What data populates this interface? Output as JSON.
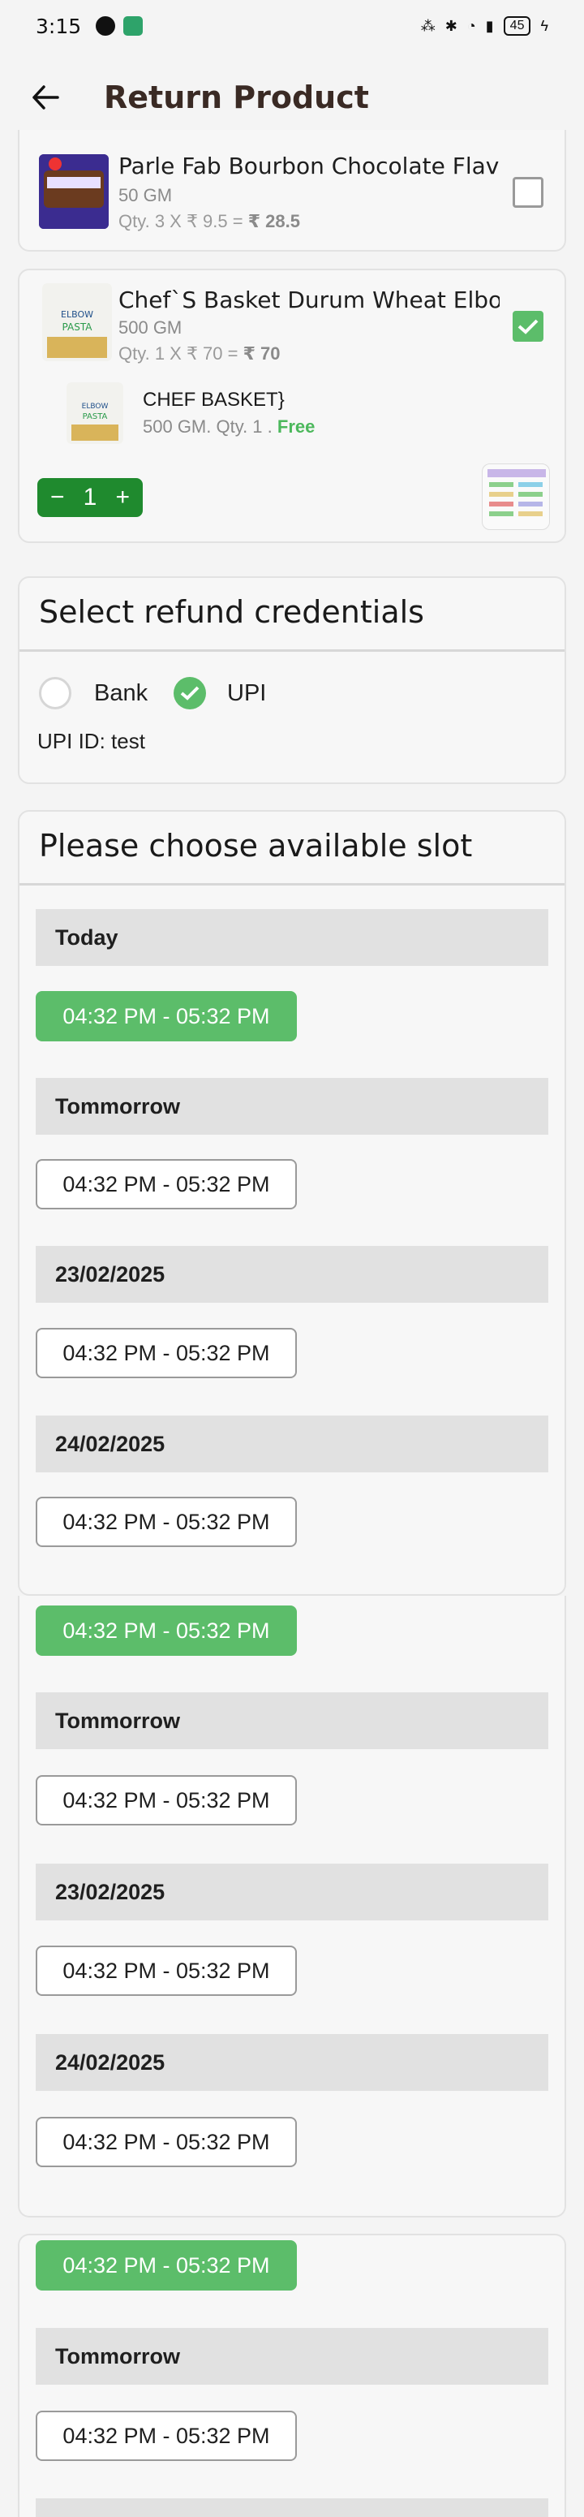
{
  "status_bar": {
    "time": "3:15",
    "battery": "45"
  },
  "header": {
    "title": "Return Product"
  },
  "products": [
    {
      "name": "Parle Fab Bourbon Chocolate Flav...",
      "weight": "50 GM",
      "qty_text": "Qty. 3 X ₹ 9.5  =  ",
      "total": "₹ 28.5",
      "checked": false
    },
    {
      "name": "Chef`S Basket Durum Wheat Elbo...",
      "weight": "500 GM",
      "qty_text": "Qty. 1 X ₹ 70  =  ",
      "total": "₹ 70",
      "checked": true
    }
  ],
  "free_item": {
    "name": "CHEF BASKET}",
    "detail": "500 GM. Qty. 1 . ",
    "free_label": "Free"
  },
  "stepper": {
    "minus": "−",
    "value": "1",
    "plus": "+"
  },
  "refund": {
    "title": "Select refund credentials",
    "options": [
      {
        "label": "Bank",
        "selected": false
      },
      {
        "label": "UPI",
        "selected": true
      }
    ],
    "upi_id": "UPI ID: test"
  },
  "slots": {
    "title": "Please choose available slot",
    "days": [
      {
        "label": "Today",
        "slot": "04:32 PM - 05:32 PM",
        "selected": true
      },
      {
        "label": "Tommorrow",
        "slot": "04:32 PM - 05:32 PM",
        "selected": false
      },
      {
        "label": "23/02/2025",
        "slot": "04:32 PM - 05:32 PM",
        "selected": false
      },
      {
        "label": "24/02/2025",
        "slot": "04:32 PM - 05:32 PM",
        "selected": false
      }
    ],
    "repeat1": [
      {
        "slot": "04:32 PM - 05:32 PM",
        "selected": true
      },
      {
        "label": "Tommorrow",
        "slot": "04:32 PM - 05:32 PM"
      },
      {
        "label": "23/02/2025",
        "slot": "04:32 PM - 05:32 PM"
      },
      {
        "label": "24/02/2025",
        "slot": "04:32 PM - 05:32 PM"
      }
    ],
    "repeat2": [
      {
        "slot": "04:32 PM - 05:32 PM",
        "selected": true
      },
      {
        "label": "Tommorrow",
        "slot": "04:32 PM - 05:32 PM"
      }
    ]
  },
  "colors": {
    "accent": "#5cbd6a",
    "stepper": "#1f8a2e",
    "title": "#3a2a24"
  }
}
